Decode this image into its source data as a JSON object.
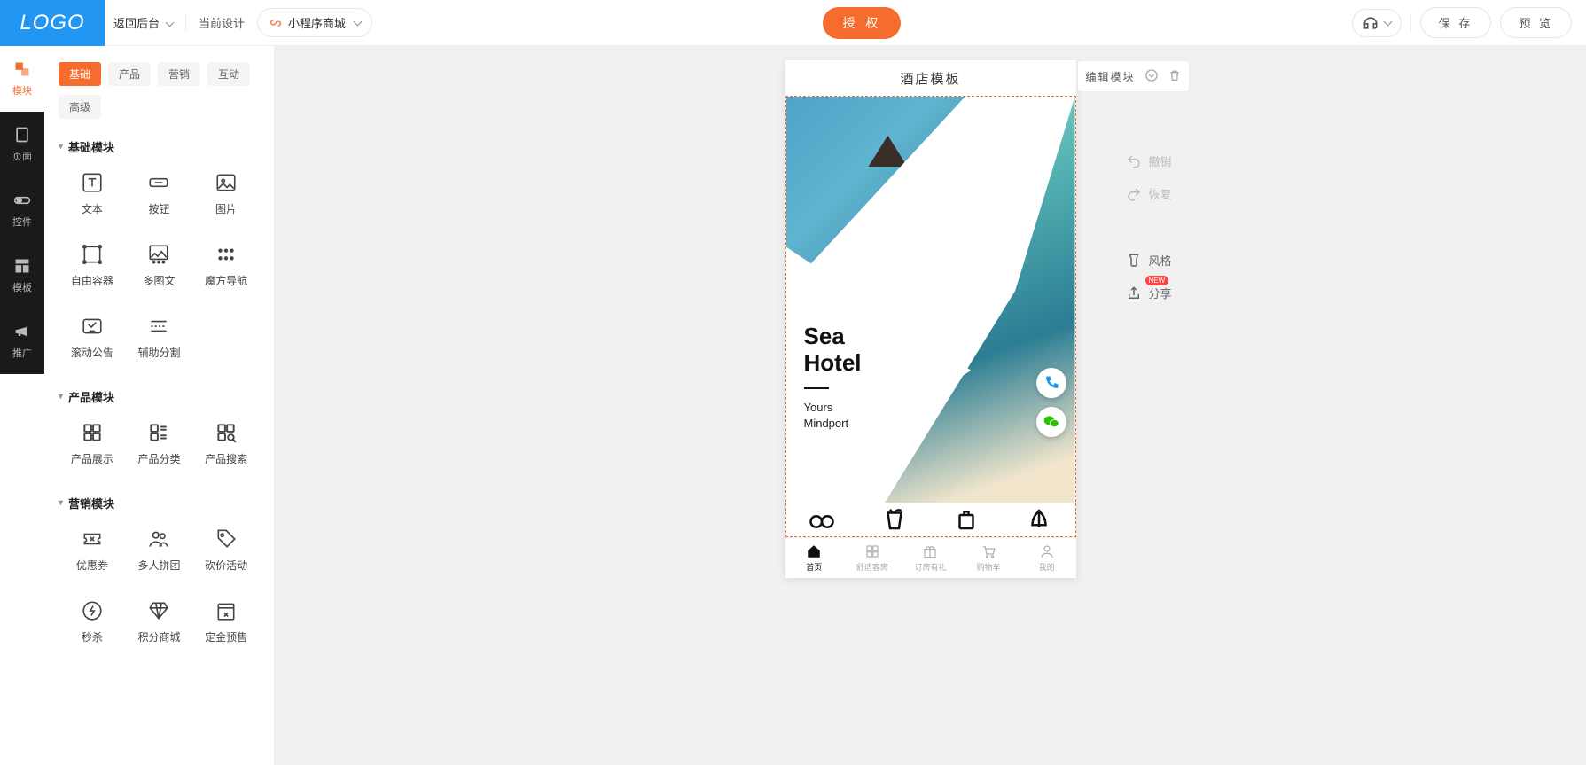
{
  "topbar": {
    "logo": "LOGO",
    "back": "返回后台",
    "current_design_label": "当前设计",
    "design_name": "小程序商城",
    "auth": "授 权",
    "save": "保 存",
    "preview": "预 览"
  },
  "rail": [
    {
      "label": "模块",
      "active": true
    },
    {
      "label": "页面"
    },
    {
      "label": "控件"
    },
    {
      "label": "模板"
    },
    {
      "label": "推广"
    }
  ],
  "panel": {
    "tabs": [
      "基础",
      "产品",
      "营销",
      "互动"
    ],
    "tabs2": [
      "高级"
    ],
    "sections": [
      {
        "title": "基础模块",
        "items": [
          "文本",
          "按钮",
          "图片",
          "自由容器",
          "多图文",
          "魔方导航",
          "滚动公告",
          "辅助分割"
        ]
      },
      {
        "title": "产品模块",
        "items": [
          "产品展示",
          "产品分类",
          "产品搜索"
        ]
      },
      {
        "title": "营销模块",
        "items": [
          "优惠券",
          "多人拼团",
          "砍价活动",
          "秒杀",
          "积分商城",
          "定金预售"
        ]
      }
    ]
  },
  "phone": {
    "title": "酒店模板",
    "edit_module": "编辑模块",
    "hero_title1": "Sea",
    "hero_title2": "Hotel",
    "hero_sub1": "Yours",
    "hero_sub2": "Mindport",
    "tabbar": [
      "首页",
      "舒适客房",
      "订房有礼",
      "购物车",
      "我的"
    ]
  },
  "right_actions": {
    "undo": "撤销",
    "redo": "恢复",
    "style": "风格",
    "share": "分享",
    "new": "NEW"
  }
}
